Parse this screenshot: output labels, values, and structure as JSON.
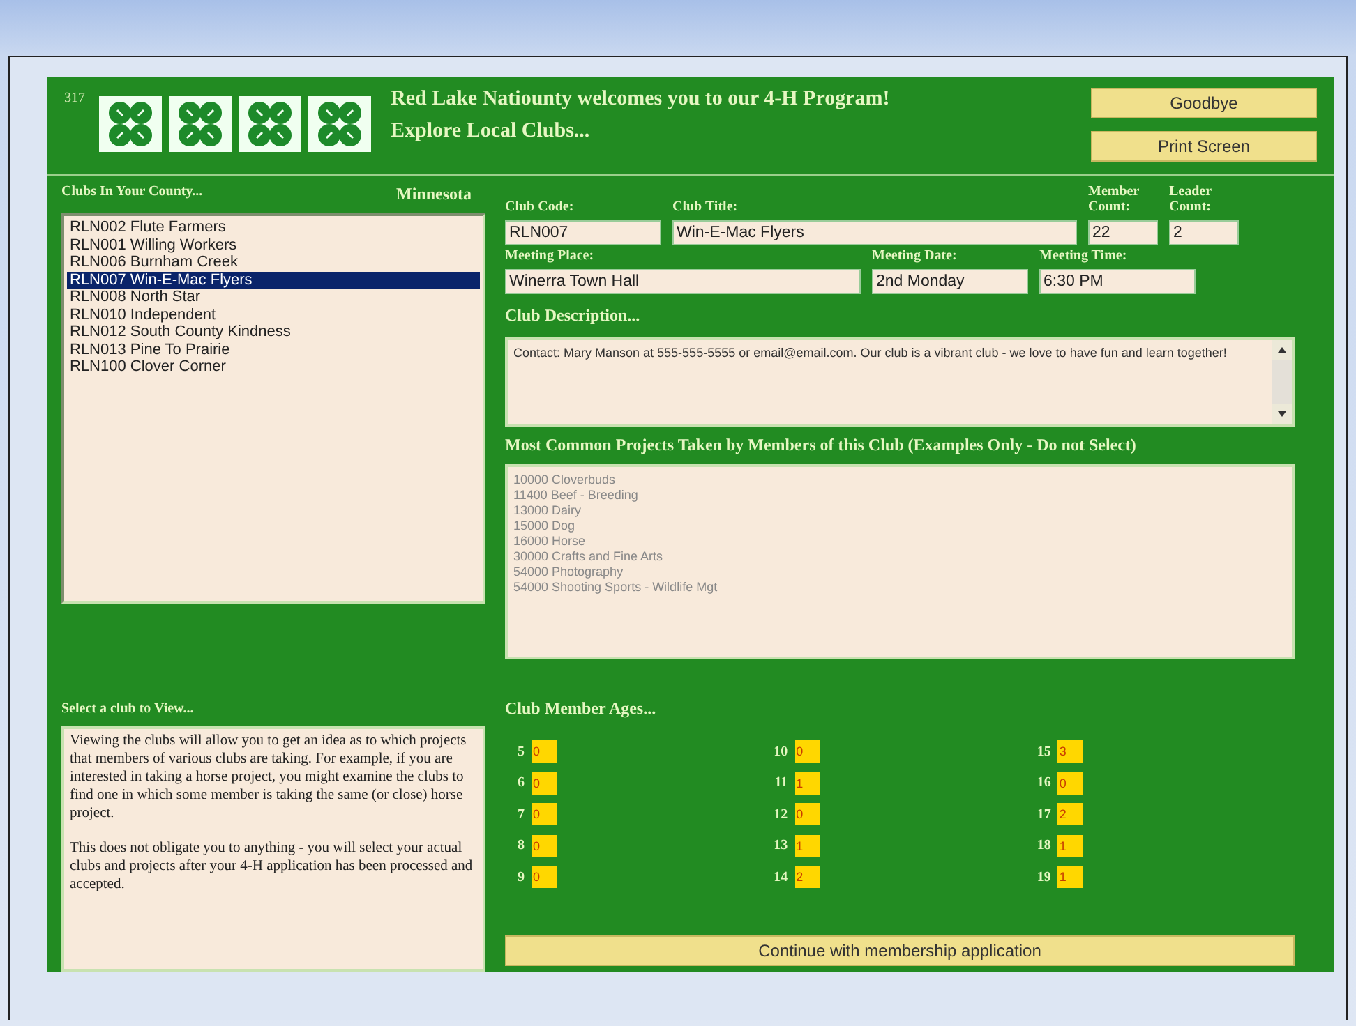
{
  "header": {
    "code": "317",
    "title_lines": [
      "Red Lake Natiounty welcomes you to our 4-H Program!",
      "Explore Local Clubs..."
    ],
    "buttons": [
      "Goodbye",
      "Print Screen"
    ]
  },
  "clubs": {
    "label": "Clubs In Your County...",
    "state": "Minnesota",
    "items": [
      {
        "label": "RLN002 Flute Farmers",
        "selected": false
      },
      {
        "label": "RLN001 Willing Workers",
        "selected": false
      },
      {
        "label": "RLN006 Burnham Creek",
        "selected": false
      },
      {
        "label": "RLN007 Win-E-Mac Flyers",
        "selected": true
      },
      {
        "label": "RLN008 North Star",
        "selected": false
      },
      {
        "label": "RLN010 Independent",
        "selected": false
      },
      {
        "label": "RLN012 South County Kindness",
        "selected": false
      },
      {
        "label": "RLN013 Pine To Prairie",
        "selected": false
      },
      {
        "label": "RLN100 Clover Corner",
        "selected": false
      }
    ]
  },
  "help": {
    "label": "Select a club to View...",
    "paragraphs": [
      "Viewing the clubs will allow you to get an idea as to which projects that members of various clubs are taking. For example, if you are interested in taking a horse project, you might examine the clubs to find one in which some member is taking the same (or close) horse project.",
      "This does not obligate you to anything - you will select your actual clubs and projects after your 4-H application has been processed and accepted."
    ]
  },
  "fields": [
    {
      "label": "Club Code:",
      "value": "RLN007"
    },
    {
      "label": "Club Title:",
      "value": "Win-E-Mac Flyers"
    },
    {
      "label": "Member Count:",
      "value": "22"
    },
    {
      "label": "Leader Count:",
      "value": "2"
    },
    {
      "label": "Meeting Place:",
      "value": "Winerra Town Hall"
    },
    {
      "label": "Meeting Date:",
      "value": "2nd Monday"
    },
    {
      "label": "Meeting Time:",
      "value": "6:30 PM"
    }
  ],
  "description": {
    "label": "Club Description...",
    "text": "Contact: Mary Manson at 555-555-5555 or email@email.com. Our club is a vibrant club - we love to have fun and learn together!"
  },
  "projects": {
    "label": "Most Common Projects Taken by Members of this Club (Examples Only - Do not Select)",
    "disabled": true,
    "items": [
      "10000 Cloverbuds",
      "11400 Beef - Breeding",
      "13000 Dairy",
      "15000 Dog",
      "16000 Horse",
      "30000 Crafts and Fine Arts",
      "54000 Photography",
      "54000 Shooting Sports - Wildlife Mgt"
    ]
  },
  "ages": {
    "label": "Club Member Ages...",
    "items": [
      {
        "age": "5",
        "count": "0"
      },
      {
        "age": "6",
        "count": "0"
      },
      {
        "age": "7",
        "count": "0"
      },
      {
        "age": "8",
        "count": "0"
      },
      {
        "age": "9",
        "count": "0"
      },
      {
        "age": "10",
        "count": "0"
      },
      {
        "age": "11",
        "count": "1"
      },
      {
        "age": "12",
        "count": "0"
      },
      {
        "age": "13",
        "count": "1"
      },
      {
        "age": "14",
        "count": "2"
      },
      {
        "age": "15",
        "count": "3"
      },
      {
        "age": "16",
        "count": "0"
      },
      {
        "age": "17",
        "count": "2"
      },
      {
        "age": "18",
        "count": "1"
      },
      {
        "age": "19",
        "count": "1"
      }
    ]
  },
  "continue_button": "Continue with membership application"
}
